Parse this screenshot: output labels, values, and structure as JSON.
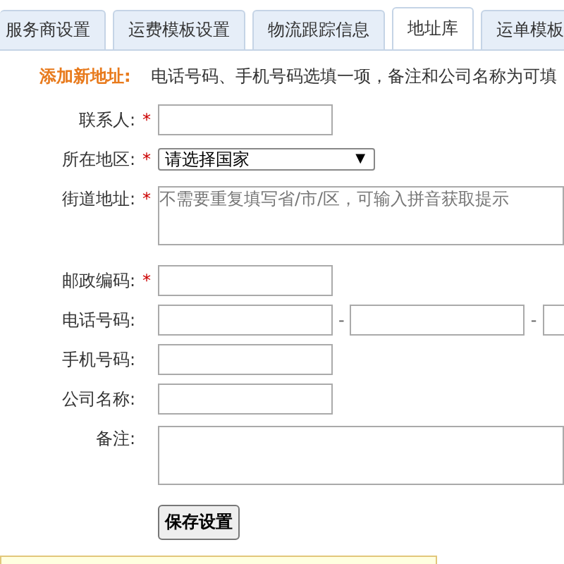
{
  "tabs": [
    {
      "label": "服务商设置",
      "selected": false
    },
    {
      "label": "运费模板设置",
      "selected": false
    },
    {
      "label": "物流跟踪信息",
      "selected": false
    },
    {
      "label": "地址库",
      "selected": true
    },
    {
      "label": "运单模板",
      "selected": false
    }
  ],
  "notice": {
    "title": "添加新地址:",
    "text": "电话号码、手机号码选填一项，备注和公司名称为可填"
  },
  "fields": [
    {
      "kind": "text",
      "label": "联系人:",
      "required": true
    },
    {
      "kind": "select",
      "label": "所在地区:",
      "required": true,
      "value": "请选择国家",
      "arrow": "▼"
    },
    {
      "kind": "textarea",
      "label": "街道地址:",
      "required": true,
      "placeholder": "不需要重复填写省/市/区，可输入拼音获取提示"
    },
    {
      "kind": "text",
      "label": "邮政编码:",
      "required": true
    },
    {
      "kind": "phone",
      "label": "电话号码:",
      "required": false,
      "separators": [
        "-",
        "-"
      ]
    },
    {
      "kind": "text",
      "label": "手机号码:",
      "required": false
    },
    {
      "kind": "text",
      "label": "公司名称:",
      "required": false
    },
    {
      "kind": "remark",
      "label": "备注:",
      "required": false
    }
  ],
  "required_mark": "*",
  "save_button": "保存设置"
}
